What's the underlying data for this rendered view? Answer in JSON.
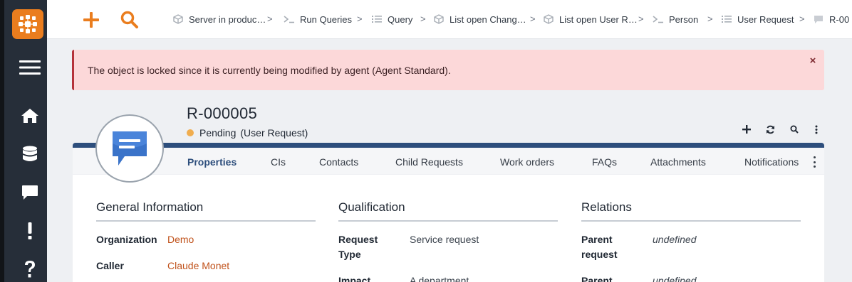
{
  "app": {
    "logo": "itop-logo-icon"
  },
  "sidebar": {
    "items": [
      {
        "name": "menu-icon"
      },
      {
        "name": "home-icon"
      },
      {
        "name": "database-icon"
      },
      {
        "name": "chat-icon"
      },
      {
        "name": "exclamation-icon"
      },
      {
        "name": "question-icon"
      }
    ]
  },
  "topbar": {
    "actions": [
      {
        "name": "plus-icon",
        "color": "#ea7d1e"
      },
      {
        "name": "search-icon",
        "color": "#ea7d1e"
      }
    ],
    "breadcrumbs": [
      {
        "label": "Server in produc…",
        "icon": "cube-icon"
      },
      {
        "label": "Run Queries",
        "icon": "terminal-icon"
      },
      {
        "label": "Query",
        "icon": "list-icon"
      },
      {
        "label": "List open Chang…",
        "icon": "cube-icon"
      },
      {
        "label": "List open User R…",
        "icon": "cube-icon"
      },
      {
        "label": "Person",
        "icon": "terminal-icon"
      },
      {
        "label": "User Request",
        "icon": "list-icon"
      },
      {
        "label": "R-00",
        "icon": "chat-icon"
      }
    ]
  },
  "alert": {
    "message": "The object is locked since it is currently being modified by agent (Agent Standard).",
    "close": "×"
  },
  "object": {
    "title": "R-000005",
    "status": "Pending",
    "status_color": "#f0ad4e",
    "class": "(User Request)",
    "actions": [
      "plus-icon",
      "refresh-icon",
      "search-icon",
      "more-vertical-icon"
    ]
  },
  "tabs": [
    {
      "label": "Properties",
      "active": true
    },
    {
      "label": "CIs"
    },
    {
      "label": "Contacts"
    },
    {
      "label": "Child Requests"
    },
    {
      "label": "Work orders"
    },
    {
      "label": "FAQs"
    },
    {
      "label": "Attachments"
    },
    {
      "label": "Notifications"
    }
  ],
  "sections": {
    "general": {
      "title": "General Information",
      "fields": [
        {
          "label": "Organization",
          "value": "Demo"
        },
        {
          "label": "Caller",
          "value": "Claude Monet"
        }
      ]
    },
    "qualification": {
      "title": "Qualification",
      "fields": [
        {
          "label": "Request Type",
          "value": "Service request"
        },
        {
          "label": "Impact",
          "value": "A department"
        }
      ]
    },
    "relations": {
      "title": "Relations",
      "fields": [
        {
          "label": "Parent request",
          "value": "undefined"
        },
        {
          "label": "Parent",
          "value": "undefined"
        }
      ]
    }
  },
  "colors": {
    "accent": "#ea7d1e",
    "panel_header": "#2d4e7c",
    "alert_bg": "#fcd8d9",
    "link": "#c0521b"
  }
}
